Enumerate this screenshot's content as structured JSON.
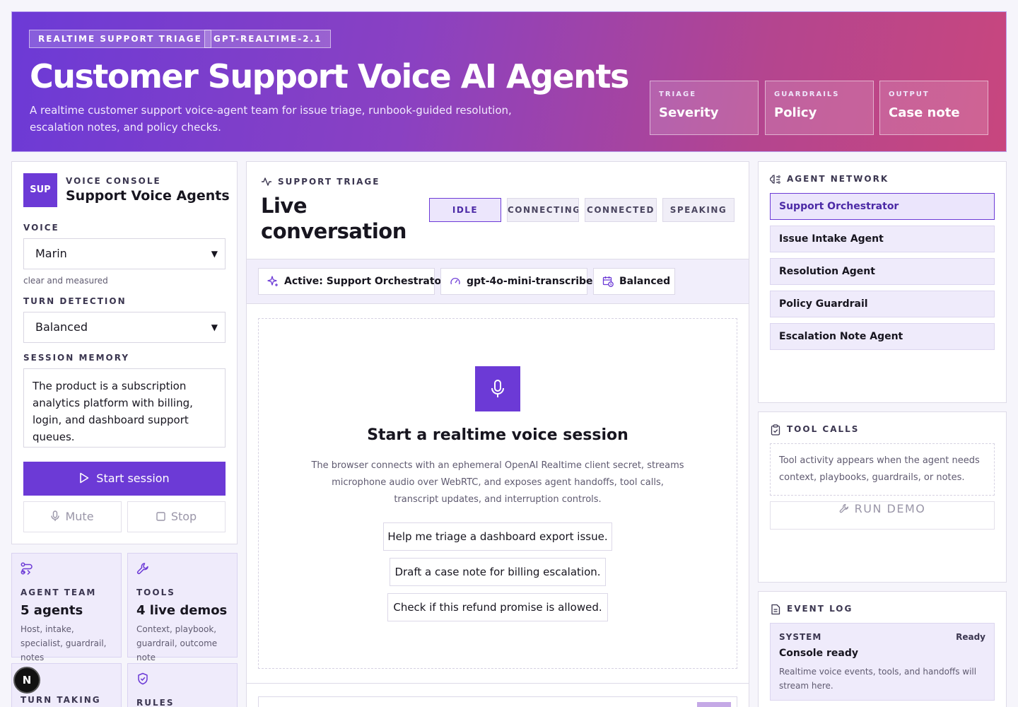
{
  "hero": {
    "chips": [
      "REALTIME SUPPORT TRIAGE",
      "GPT-REALTIME-2.1"
    ],
    "title": "Customer Support Voice AI Agents",
    "subtitle": "A realtime customer support voice-agent team for issue triage, runbook-guided resolution, escalation notes, and policy checks.",
    "stats": [
      {
        "key": "TRIAGE",
        "value": "Severity"
      },
      {
        "key": "GUARDRAILS",
        "value": "Policy"
      },
      {
        "key": "OUTPUT",
        "value": "Case note"
      }
    ]
  },
  "console": {
    "badge": "SUP",
    "eyebrow": "VOICE CONSOLE",
    "title": "Support Voice Agents",
    "voice_label": "VOICE",
    "voice_value": "Marin",
    "voice_hint": "clear and measured",
    "turn_label": "TURN DETECTION",
    "turn_value": "Balanced",
    "memory_label": "SESSION MEMORY",
    "memory_text": "The product is a subscription analytics platform with billing, login, and dashboard support queues.",
    "start_label": "Start session",
    "mute_label": "Mute",
    "stop_label": "Stop"
  },
  "cards": [
    {
      "title": "AGENT TEAM",
      "value": "5 agents",
      "desc": "Host, intake, specialist, guardrail, notes",
      "icon": "route-icon"
    },
    {
      "title": "TOOLS",
      "value": "4 live demos",
      "desc": "Context, playbook, guardrail, outcome note",
      "icon": "wrench-icon"
    },
    {
      "title": "TURN TAKING",
      "icon": "none"
    },
    {
      "title": "RULES",
      "icon": "shield-check-icon"
    }
  ],
  "conversation": {
    "eyebrow": "SUPPORT TRIAGE",
    "title": "Live conversation",
    "states": [
      "IDLE",
      "CONNECTING",
      "CONNECTED",
      "SPEAKING"
    ],
    "active_state": "IDLE",
    "pills": [
      "Active: Support Orchestrator",
      "gpt-4o-mini-transcribe",
      "Balanced"
    ],
    "empty_title": "Start a realtime voice session",
    "empty_desc": "The browser connects with an ephemeral OpenAI Realtime client secret, streams microphone audio over WebRTC, and exposes agent handoffs, tool calls, transcript updates, and interruption controls.",
    "prompts": [
      "Help me triage a dashboard export issue.",
      "Draft a case note for billing escalation.",
      "Check if this refund promise is allowed."
    ]
  },
  "network": {
    "label": "AGENT NETWORK",
    "agents": [
      "Support Orchestrator",
      "Issue Intake Agent",
      "Resolution Agent",
      "Policy Guardrail",
      "Escalation Note Agent"
    ],
    "selected": "Support Orchestrator"
  },
  "tools": {
    "label": "TOOL CALLS",
    "placeholder": "Tool activity appears when the agent needs context, playbooks, guardrails, or notes.",
    "run_label": "RUN DEMO"
  },
  "events": {
    "label": "EVENT LOG",
    "items": [
      {
        "source": "SYSTEM",
        "status": "Ready",
        "title": "Console ready",
        "desc": "Realtime voice events, tools, and handoffs will stream here."
      }
    ]
  },
  "avatar_letter": "N",
  "colors": {
    "accent": "#6c3ad6",
    "accent_light": "#efebfb"
  }
}
